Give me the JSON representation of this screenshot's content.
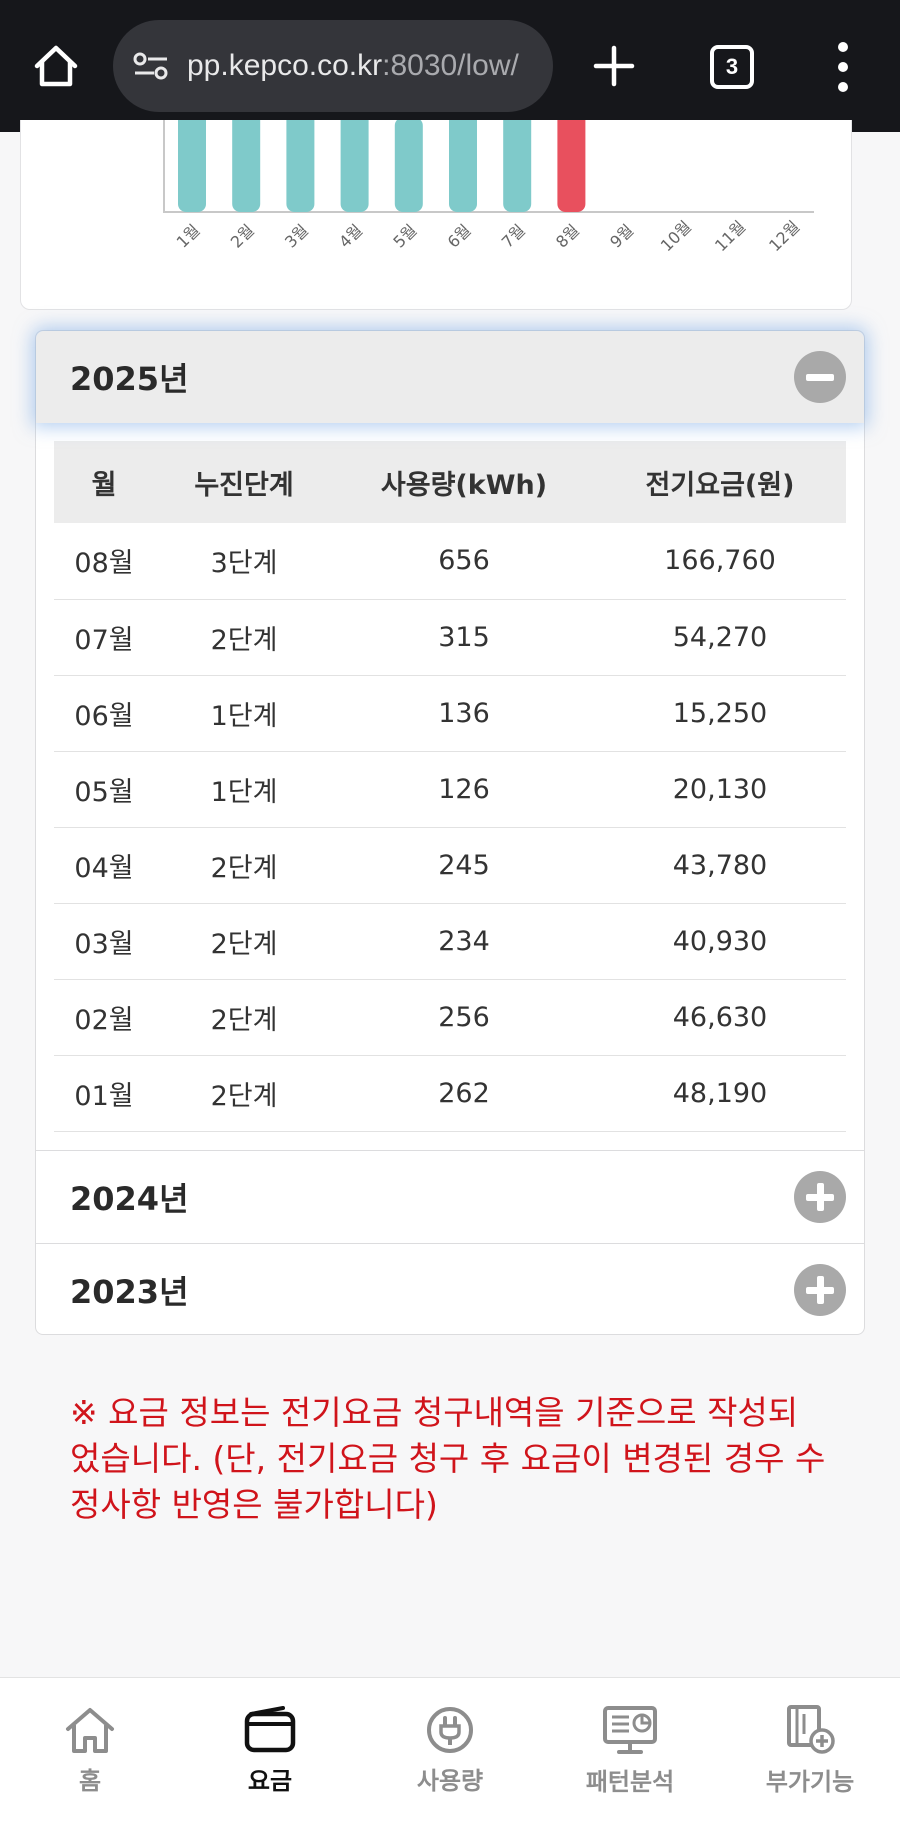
{
  "browser": {
    "url_main": "pp.kepco.co.kr",
    "url_rest": ":8030/low/",
    "tab_count": "3"
  },
  "chart_data": {
    "type": "bar",
    "categories": [
      "1월",
      "2월",
      "3월",
      "4월",
      "5월",
      "6월",
      "7월",
      "8월",
      "9월",
      "10월",
      "11월",
      "12월"
    ],
    "values": [
      262,
      256,
      234,
      245,
      126,
      136,
      315,
      656,
      null,
      null,
      null,
      null
    ],
    "highlight_category": "8월",
    "colors": {
      "normal": "#7fcaca",
      "highlight": "#e8505e"
    }
  },
  "accordion": [
    {
      "year": "2025년",
      "expanded": true,
      "headers": [
        "월",
        "누진단계",
        "사용량(kWh)",
        "전기요금(원)"
      ],
      "rows": [
        [
          "08월",
          "3단계",
          "656",
          "166,760"
        ],
        [
          "07월",
          "2단계",
          "315",
          "54,270"
        ],
        [
          "06월",
          "1단계",
          "136",
          "15,250"
        ],
        [
          "05월",
          "1단계",
          "126",
          "20,130"
        ],
        [
          "04월",
          "2단계",
          "245",
          "43,780"
        ],
        [
          "03월",
          "2단계",
          "234",
          "40,930"
        ],
        [
          "02월",
          "2단계",
          "256",
          "46,630"
        ],
        [
          "01월",
          "2단계",
          "262",
          "48,190"
        ]
      ]
    },
    {
      "year": "2024년",
      "expanded": false
    },
    {
      "year": "2023년",
      "expanded": false
    }
  ],
  "notice": {
    "line1": "※ 요금 정보는 전기요금 청구내역을 기준으로 작성되",
    "line2": "었습니다. (단, 전기요금 청구 후 요금이 변경된 경우 수",
    "line3": "정사항 반영은 불가합니다)",
    "color": "#d0141b"
  },
  "bottom_nav": [
    {
      "label": "홈",
      "icon": "home-icon",
      "active": false
    },
    {
      "label": "요금",
      "icon": "wallet-icon",
      "active": true
    },
    {
      "label": "사용량",
      "icon": "plug-icon",
      "active": false
    },
    {
      "label": "패턴분석",
      "icon": "analysis-icon",
      "active": false
    },
    {
      "label": "부가기능",
      "icon": "addon-icon",
      "active": false
    }
  ]
}
